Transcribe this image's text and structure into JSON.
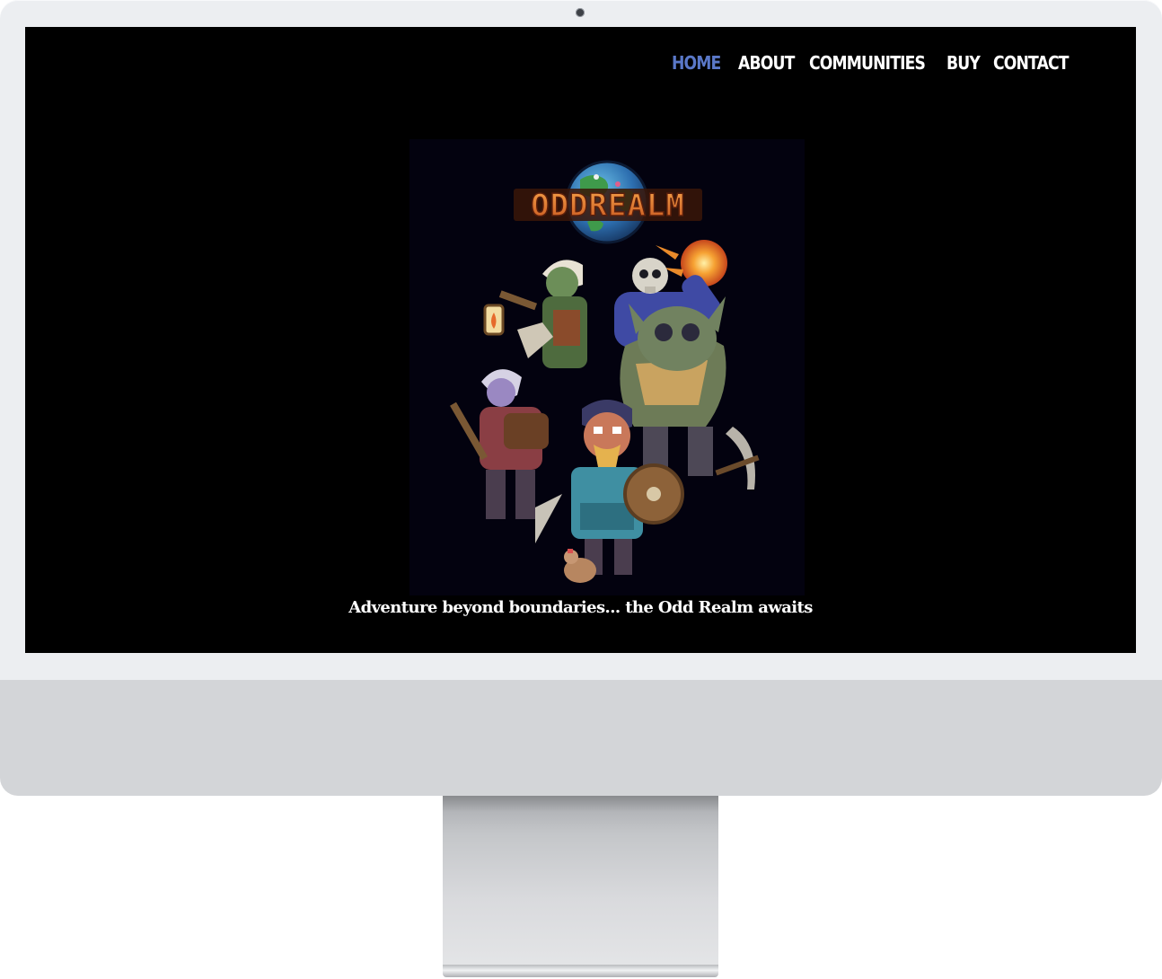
{
  "nav": {
    "items": [
      {
        "label": "HOME",
        "active": true
      },
      {
        "label": "ABOUT",
        "active": false
      },
      {
        "label": "COMMUNITIES",
        "active": false
      },
      {
        "label": "BUY",
        "active": false
      },
      {
        "label": "CONTACT",
        "active": false
      }
    ]
  },
  "hero": {
    "logo_text": "ODDREALM",
    "tagline": "Adventure beyond boundaries... the Odd Realm awaits"
  },
  "colors": {
    "page_background": "#000000",
    "nav_active": "#5a78c8",
    "nav_default": "#ffffff",
    "logo_orange": "#e8792c"
  }
}
